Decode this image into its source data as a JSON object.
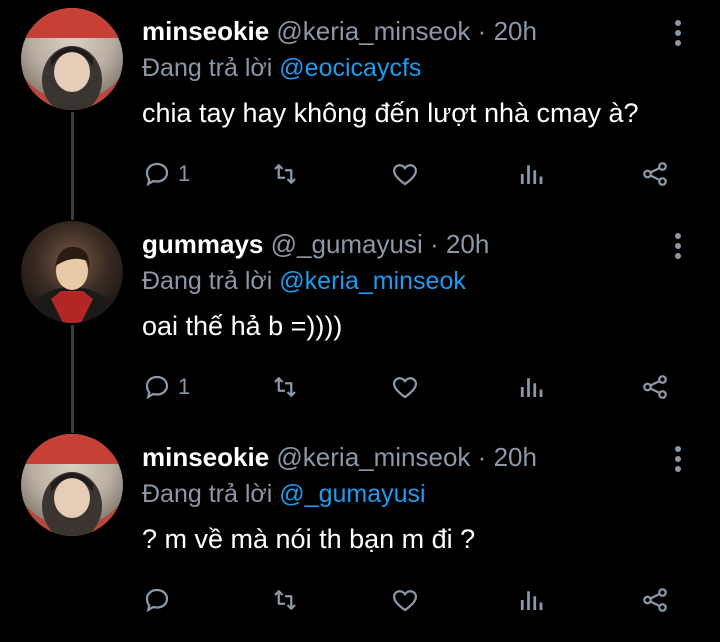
{
  "tweets": [
    {
      "name": "minseokie",
      "handle": "@keria_minseok",
      "dot": "·",
      "time": "20h",
      "reply_prefix": "Đang trả lời",
      "reply_to": "@eocicaycfs",
      "text": "chia tay hay không đến lượt nhà cmay à?",
      "reply_count": "1",
      "avatar": "avatar-minseokie"
    },
    {
      "name": "gummays",
      "handle": "@_gumayusi",
      "dot": "·",
      "time": "20h",
      "reply_prefix": "Đang trả lời",
      "reply_to": "@keria_minseok",
      "text": "oai thế hả b =))))",
      "reply_count": "1",
      "avatar": "avatar-gummays"
    },
    {
      "name": "minseokie",
      "handle": "@keria_minseok",
      "dot": "·",
      "time": "20h",
      "reply_prefix": "Đang trả lời",
      "reply_to": "@_gumayusi",
      "text": "? m về mà nói th bạn m đi ?",
      "reply_count": "",
      "avatar": "avatar-minseokie"
    }
  ],
  "icons": [
    "reply-icon",
    "retweet-icon",
    "like-icon",
    "analytics-icon",
    "share-icon",
    "more-icon"
  ],
  "colors": {
    "background": "#000000",
    "muted": "#8b98a5",
    "link": "#1d9bf0",
    "thread_line": "#3b3f44"
  }
}
